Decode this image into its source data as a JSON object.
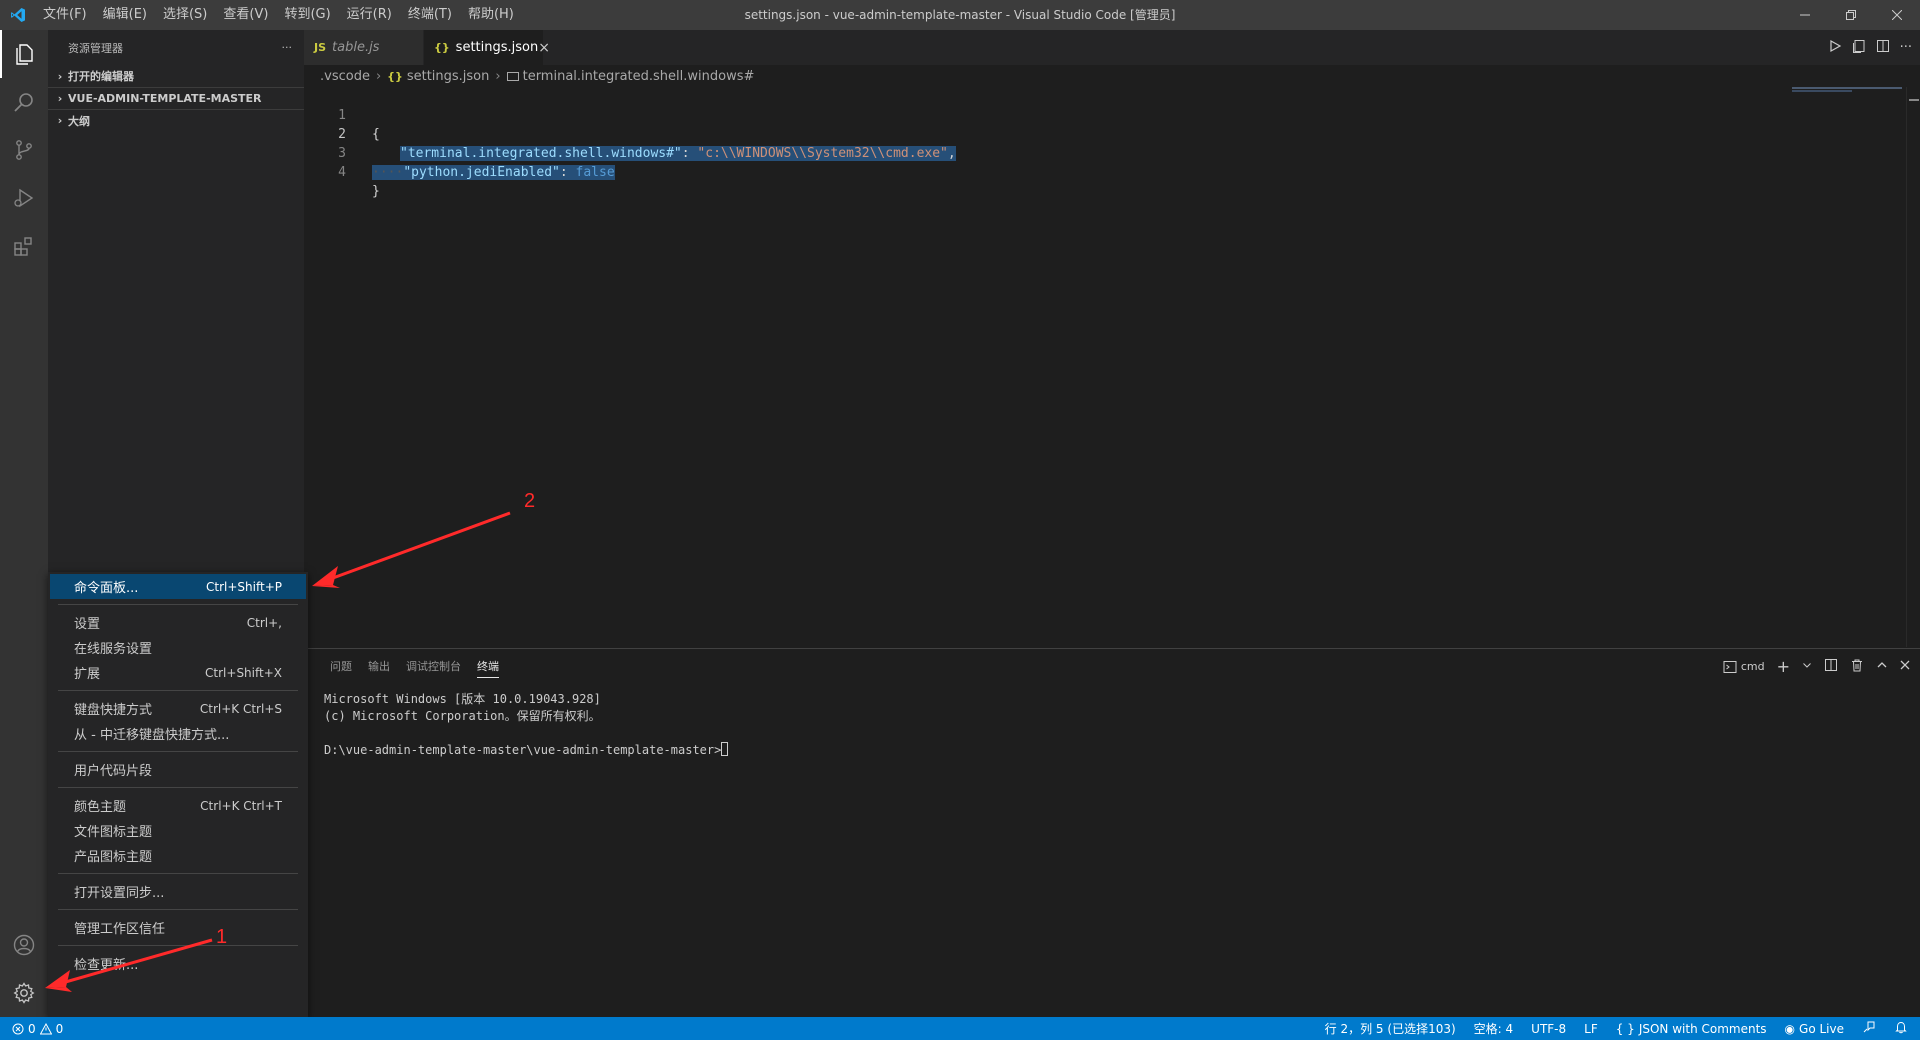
{
  "titlebar": {
    "menu": [
      "文件(F)",
      "编辑(E)",
      "选择(S)",
      "查看(V)",
      "转到(G)",
      "运行(R)",
      "终端(T)",
      "帮助(H)"
    ],
    "title": "settings.json - vue-admin-template-master - Visual Studio Code [管理员]"
  },
  "sidebar": {
    "header": "资源管理器",
    "more": "···",
    "sections": [
      "打开的编辑器",
      "VUE-ADMIN-TEMPLATE-MASTER",
      "大纲"
    ]
  },
  "tabs": [
    {
      "label": "table.js",
      "icon": "JS",
      "icon_color": "#cbcb41"
    },
    {
      "label": "settings.json",
      "icon": "{}",
      "icon_color": "#cbcb41",
      "close": "×"
    }
  ],
  "breadcrumb": {
    "folder": ".vscode",
    "file": "settings.json",
    "file_icon": "{}",
    "symbol": "terminal.integrated.shell.windows#"
  },
  "code": {
    "line_numbers": [
      "1",
      "2",
      "3",
      "4"
    ],
    "open_brace": "{",
    "close_brace": "}",
    "key1": "\"terminal.integrated.shell.windows#\"",
    "colon1": ": ",
    "val1": "\"c:\\\\WINDOWS\\\\System32\\\\cmd.exe\"",
    "comma1": ",",
    "ws3": "····",
    "key2": "\"python.jediEnabled\"",
    "colon2": ": ",
    "val2": "false"
  },
  "panel": {
    "tabs": [
      "问题",
      "输出",
      "调试控制台",
      "终端"
    ],
    "terminal_name": "cmd",
    "terminal_lines": [
      "Microsoft Windows [版本 10.0.19043.928]",
      "(c) Microsoft Corporation。保留所有权利。",
      "",
      "D:\\vue-admin-template-master\\vue-admin-template-master>"
    ]
  },
  "menu": {
    "groups": [
      [
        {
          "label": "命令面板...",
          "shortcut": "Ctrl+Shift+P",
          "highlight": true
        }
      ],
      [
        {
          "label": "设置",
          "shortcut": "Ctrl+,"
        },
        {
          "label": "在线服务设置",
          "shortcut": ""
        },
        {
          "label": "扩展",
          "shortcut": "Ctrl+Shift+X"
        }
      ],
      [
        {
          "label": "键盘快捷方式",
          "shortcut": "Ctrl+K Ctrl+S"
        },
        {
          "label": "从 - 中迁移键盘快捷方式...",
          "shortcut": ""
        }
      ],
      [
        {
          "label": "用户代码片段",
          "shortcut": ""
        }
      ],
      [
        {
          "label": "颜色主题",
          "shortcut": "Ctrl+K Ctrl+T"
        },
        {
          "label": "文件图标主题",
          "shortcut": ""
        },
        {
          "label": "产品图标主题",
          "shortcut": ""
        }
      ],
      [
        {
          "label": "打开设置同步...",
          "shortcut": ""
        }
      ],
      [
        {
          "label": "管理工作区信任",
          "shortcut": ""
        }
      ],
      [
        {
          "label": "检查更新...",
          "shortcut": ""
        }
      ]
    ]
  },
  "statusbar": {
    "errors": "0",
    "warnings": "0",
    "position": "行 2，列 5 (已选择103)",
    "spaces": "空格: 4",
    "encoding": "UTF-8",
    "eol": "LF",
    "language": "JSON with Comments",
    "golive": "Go Live"
  },
  "annotations": {
    "label1": "1",
    "label2": "2",
    "color": "#ff2a2a"
  },
  "colors": {
    "accent": "#007acc",
    "selection": "#094771"
  }
}
